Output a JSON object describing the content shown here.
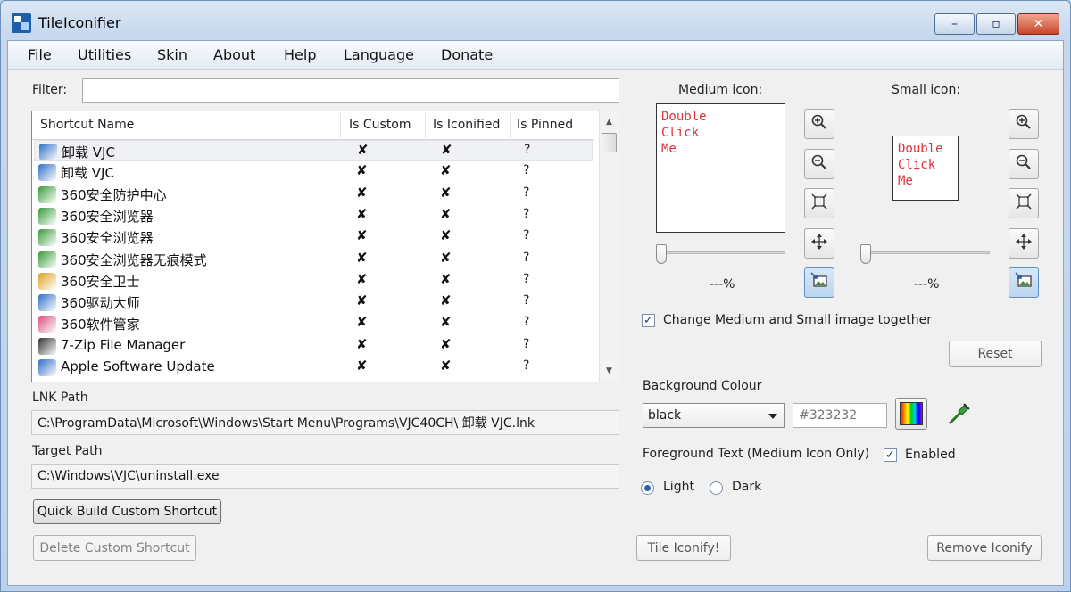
{
  "window": {
    "title": "TileIconifier",
    "min": "–",
    "max": "▫",
    "close": "✕"
  },
  "menu": [
    "File",
    "Utilities",
    "Skin",
    "About",
    "Help",
    "Language",
    "Donate"
  ],
  "filter": {
    "label": "Filter:",
    "value": ""
  },
  "shortcuts": {
    "columns": [
      "Shortcut Name",
      "Is Custom",
      "Is Iconified",
      "Is Pinned"
    ],
    "rows": [
      {
        "name": "卸载 VJC",
        "custom": "✘",
        "iconified": "✘",
        "pinned": "?",
        "icon_color": "#2f6fc7"
      },
      {
        "name": "卸载 VJC",
        "custom": "✘",
        "iconified": "✘",
        "pinned": "?",
        "icon_color": "#2f6fc7"
      },
      {
        "name": "360安全防护中心",
        "custom": "✘",
        "iconified": "✘",
        "pinned": "?",
        "icon_color": "#3a9a3a"
      },
      {
        "name": "360安全浏览器",
        "custom": "✘",
        "iconified": "✘",
        "pinned": "?",
        "icon_color": "#3a9a3a"
      },
      {
        "name": "360安全浏览器",
        "custom": "✘",
        "iconified": "✘",
        "pinned": "?",
        "icon_color": "#3a9a3a"
      },
      {
        "name": "360安全浏览器无痕模式",
        "custom": "✘",
        "iconified": "✘",
        "pinned": "?",
        "icon_color": "#3a9a3a"
      },
      {
        "name": "360安全卫士",
        "custom": "✘",
        "iconified": "✘",
        "pinned": "?",
        "icon_color": "#e0a020"
      },
      {
        "name": "360驱动大师",
        "custom": "✘",
        "iconified": "✘",
        "pinned": "?",
        "icon_color": "#2f6fc7"
      },
      {
        "name": "360软件管家",
        "custom": "✘",
        "iconified": "✘",
        "pinned": "?",
        "icon_color": "#d94f7a"
      },
      {
        "name": "7-Zip File Manager",
        "custom": "✘",
        "iconified": "✘",
        "pinned": "?",
        "icon_color": "#333333"
      },
      {
        "name": "Apple Software Update",
        "custom": "✘",
        "iconified": "✘",
        "pinned": "?",
        "icon_color": "#2f6fc7"
      }
    ]
  },
  "lnk_path": {
    "label": "LNK Path",
    "value": "C:\\ProgramData\\Microsoft\\Windows\\Start Menu\\Programs\\VJC40CH\\ 卸载 VJC.lnk"
  },
  "target_path": {
    "label": "Target Path",
    "value": "C:\\Windows\\VJC\\uninstall.exe"
  },
  "buttons": {
    "quick_build": "Quick Build Custom Shortcut",
    "delete_custom": "Delete Custom Shortcut",
    "tile_iconify": "Tile Iconify!",
    "remove_iconify": "Remove Iconify",
    "reset": "Reset"
  },
  "medium_icon": {
    "label": "Medium icon:",
    "preview_text": [
      "Double",
      "Click",
      "Me"
    ],
    "percent": "---%"
  },
  "small_icon": {
    "label": "Small icon:",
    "preview_text": [
      "Double",
      "Click",
      "Me"
    ],
    "percent": "---%"
  },
  "icon_tools": [
    "zoom-in-icon",
    "zoom-out-icon",
    "fit-icon",
    "center-icon",
    "image-icon"
  ],
  "change_together": {
    "label": "Change Medium and Small image together",
    "checked": "✓"
  },
  "background": {
    "label": "Background Colour",
    "selected": "black",
    "hex_placeholder": "#323232"
  },
  "foreground": {
    "label": "Foreground Text (Medium Icon Only)",
    "enabled_label": "Enabled",
    "enabled_checked": "✓",
    "light_label": "Light",
    "dark_label": "Dark"
  },
  "colors": {
    "preview_text": "#e0303a",
    "accent": "#2f5fa5"
  }
}
